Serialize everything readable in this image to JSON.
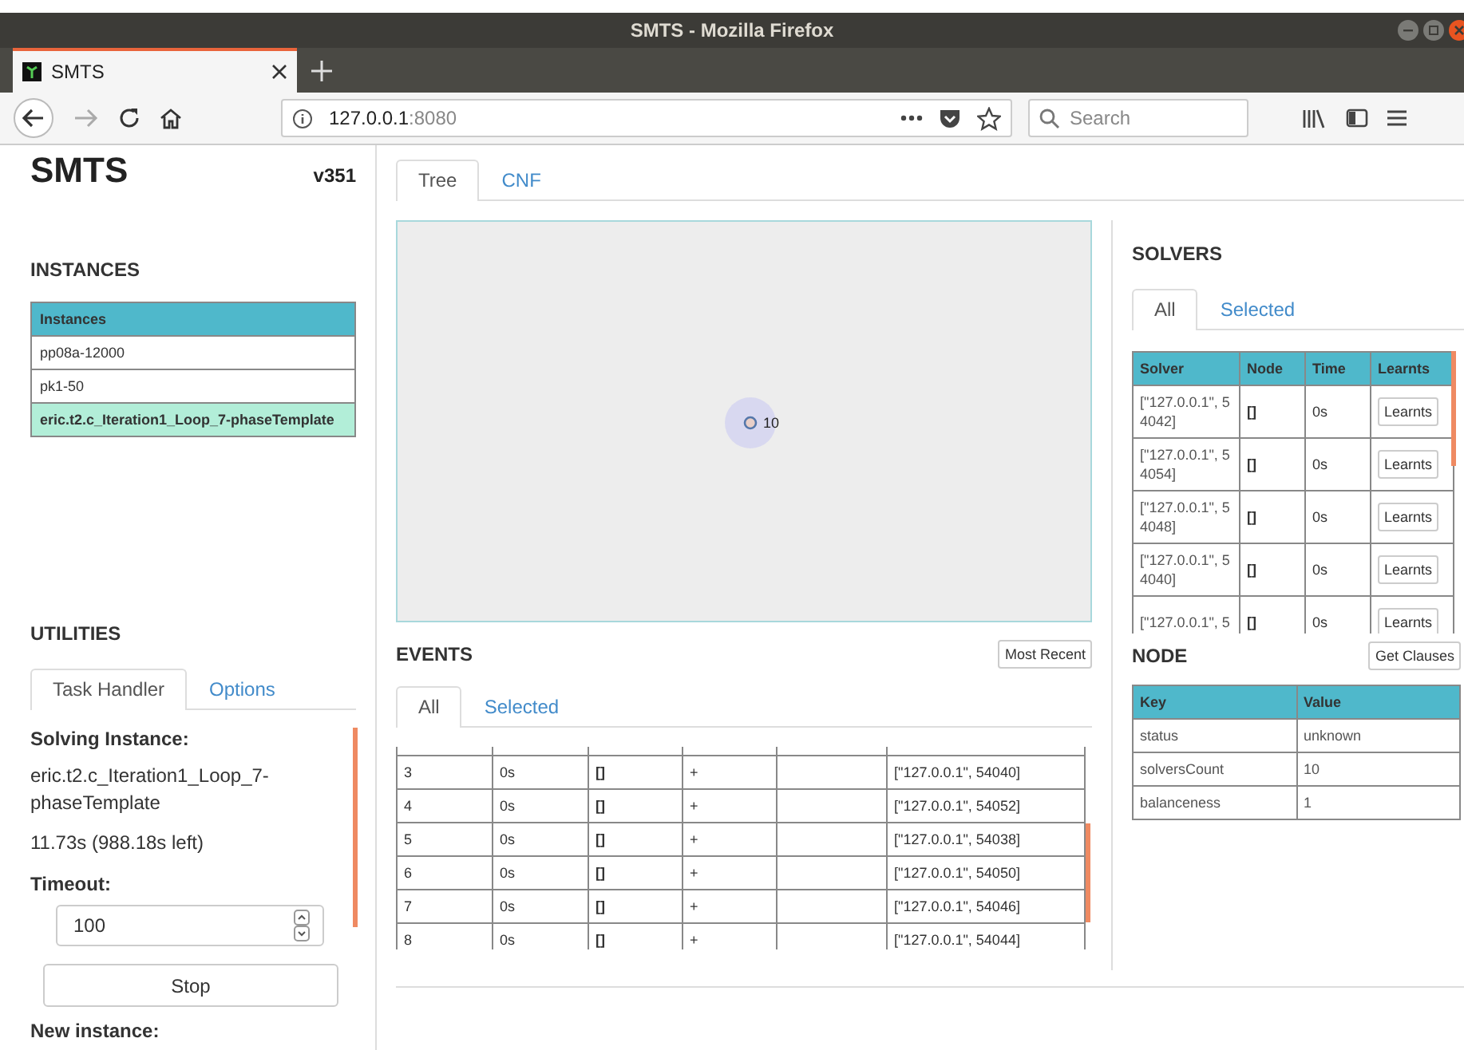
{
  "window": {
    "title": "SMTS - Mozilla Firefox"
  },
  "browser": {
    "tab_title": "SMTS",
    "url_host": "127.0.0.1",
    "url_port": ":8080",
    "search": {
      "placeholder": "Search"
    }
  },
  "sidebar": {
    "app_title": "SMTS",
    "version": "v351",
    "instances_heading": "INSTANCES",
    "instances_table": {
      "header": "Instances",
      "rows": [
        {
          "name": "pp08a-12000",
          "selected": false
        },
        {
          "name": "pk1-50",
          "selected": false
        },
        {
          "name": "eric.t2.c_Iteration1_Loop_7-phaseTemplate",
          "selected": true
        }
      ]
    },
    "utilities_heading": "UTILITIES",
    "tabs": [
      {
        "label": "Task Handler",
        "selected": true
      },
      {
        "label": "Options",
        "selected": false
      }
    ],
    "solving_label": "Solving Instance:",
    "solving_instance": "eric.t2.c_Iteration1_Loop_7-phaseTemplate",
    "elapsed": "11.73s (988.18s left)",
    "timeout_label": "Timeout:",
    "timeout_value": "100",
    "stop_button": "Stop",
    "new_instance_label": "New instance:"
  },
  "main_tabs": [
    {
      "label": "Tree",
      "selected": true
    },
    {
      "label": "CNF",
      "selected": false
    }
  ],
  "tree": {
    "node_label": "10"
  },
  "events": {
    "heading": "EVENTS",
    "button": "Most Recent",
    "tabs": [
      {
        "label": "All",
        "selected": true
      },
      {
        "label": "Selected",
        "selected": false
      }
    ],
    "rows": [
      [
        "3",
        "0s",
        "[]",
        "+",
        "",
        "[\"127.0.0.1\", 54040]"
      ],
      [
        "4",
        "0s",
        "[]",
        "+",
        "",
        "[\"127.0.0.1\", 54052]"
      ],
      [
        "5",
        "0s",
        "[]",
        "+",
        "",
        "[\"127.0.0.1\", 54038]"
      ],
      [
        "6",
        "0s",
        "[]",
        "+",
        "",
        "[\"127.0.0.1\", 54050]"
      ],
      [
        "7",
        "0s",
        "[]",
        "+",
        "",
        "[\"127.0.0.1\", 54046]"
      ],
      [
        "8",
        "0s",
        "[]",
        "+",
        "",
        "[\"127.0.0.1\", 54044]"
      ]
    ]
  },
  "solvers": {
    "heading": "SOLVERS",
    "tabs": [
      {
        "label": "All",
        "selected": true
      },
      {
        "label": "Selected",
        "selected": false
      }
    ],
    "columns": [
      "Solver",
      "Node",
      "Time",
      "Learnts"
    ],
    "rows": [
      {
        "solver": "[\"127.0.0.1\", 54042]",
        "node": "[]",
        "time": "0s",
        "button": "Learnts"
      },
      {
        "solver": "[\"127.0.0.1\", 54054]",
        "node": "[]",
        "time": "0s",
        "button": "Learnts"
      },
      {
        "solver": "[\"127.0.0.1\", 54048]",
        "node": "[]",
        "time": "0s",
        "button": "Learnts"
      },
      {
        "solver": "[\"127.0.0.1\", 54040]",
        "node": "[]",
        "time": "0s",
        "button": "Learnts"
      },
      {
        "solver": "[\"127.0.0.1\", 5",
        "node": "[]",
        "time": "0s",
        "button": "Learnts"
      }
    ]
  },
  "node": {
    "heading": "NODE",
    "button": "Get Clauses",
    "columns": [
      "Key",
      "Value"
    ],
    "rows": [
      [
        "status",
        "unknown"
      ],
      [
        "solversCount",
        "10"
      ],
      [
        "balanceness",
        "1"
      ]
    ]
  }
}
